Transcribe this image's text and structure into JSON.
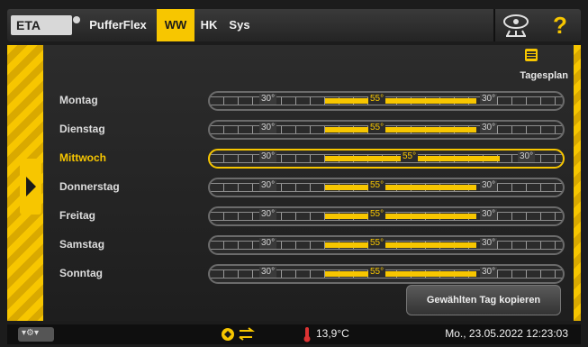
{
  "header": {
    "logo": "ETA",
    "tabs": [
      {
        "label": "PufferFlex",
        "active": false
      },
      {
        "label": "WW",
        "active": true
      },
      {
        "label": "HK",
        "active": false
      },
      {
        "label": "Sys",
        "active": false
      }
    ],
    "wifi_icon": "network-icon",
    "help_label": "?"
  },
  "colors": {
    "accent": "#f7c600",
    "background": "#1c1c1c",
    "text": "#dcdcdc"
  },
  "main": {
    "plan_label": "Tagesplan",
    "days": [
      {
        "label": "Montag",
        "temps": [
          "30°",
          "55°",
          "30°"
        ],
        "selected": false
      },
      {
        "label": "Dienstag",
        "temps": [
          "30°",
          "55°",
          "30°"
        ],
        "selected": false
      },
      {
        "label": "Mittwoch",
        "temps": [
          "30°",
          "55°",
          "30°"
        ],
        "selected": true
      },
      {
        "label": "Donnerstag",
        "temps": [
          "30°",
          "55°",
          "30°"
        ],
        "selected": false
      },
      {
        "label": "Freitag",
        "temps": [
          "30°",
          "55°",
          "30°"
        ],
        "selected": false
      },
      {
        "label": "Samstag",
        "temps": [
          "30°",
          "55°",
          "30°"
        ],
        "selected": false
      },
      {
        "label": "Sonntag",
        "temps": [
          "30°",
          "55°",
          "30°"
        ],
        "selected": false
      }
    ],
    "copy_label": "Gewählten Tag kopieren"
  },
  "footer": {
    "menu_icon": "menu-icon",
    "temperature": "13,9°C",
    "datetime": "Mo., 23.05.2022 12:23:03"
  }
}
